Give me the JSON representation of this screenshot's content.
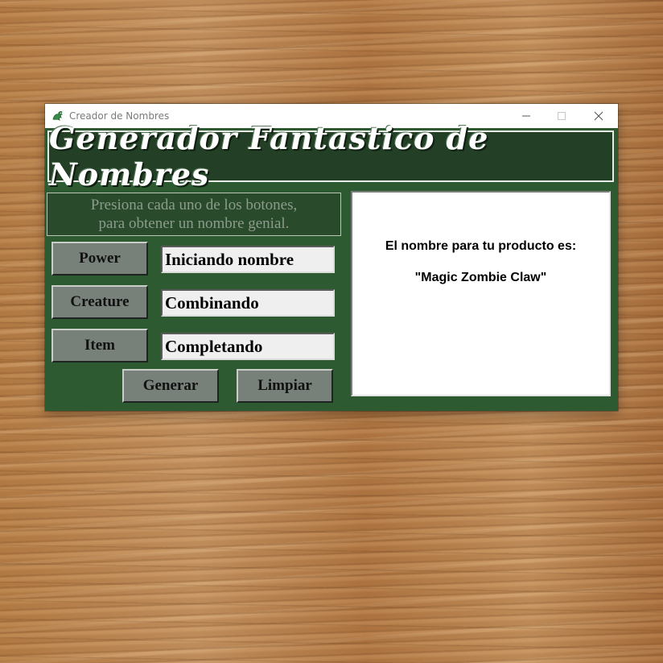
{
  "window": {
    "title": "Creador de Nombres",
    "app_icon": "dragon-icon",
    "controls": {
      "minimize": "—",
      "maximize": "☐",
      "close": "✕"
    }
  },
  "banner": {
    "title": "Generador Fantastico de Nombres"
  },
  "hint": {
    "line1": "Presiona cada uno de los botones,",
    "line2": "para obtener un nombre genial."
  },
  "buttons": {
    "power": "Power",
    "creature": "Creature",
    "item": "Item",
    "generate": "Generar",
    "clear": "Limpiar"
  },
  "fields": {
    "power": "Iniciando nombre",
    "creature": "Combinando",
    "item": "Completando"
  },
  "result": {
    "label": "El nombre para tu producto es:",
    "name": "\"Magic Zombie Claw\""
  },
  "colors": {
    "panel_green": "#2d5a31",
    "banner_green": "#233f26",
    "button_gray": "#778079"
  }
}
